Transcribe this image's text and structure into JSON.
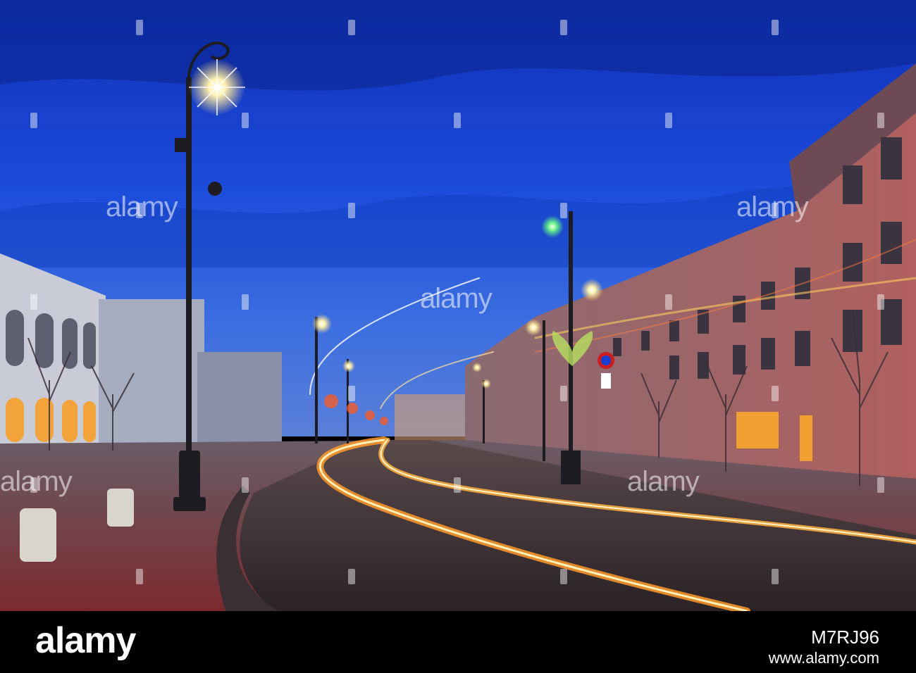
{
  "watermark": {
    "text": "alamy"
  },
  "footer": {
    "logo": "alamy",
    "image_id": "M7RJ96",
    "url": "www.alamy.com"
  },
  "colors": {
    "sky": "#1a3fd0",
    "street_light_trail": "#ffb84a",
    "footer_bg": "#000000"
  }
}
